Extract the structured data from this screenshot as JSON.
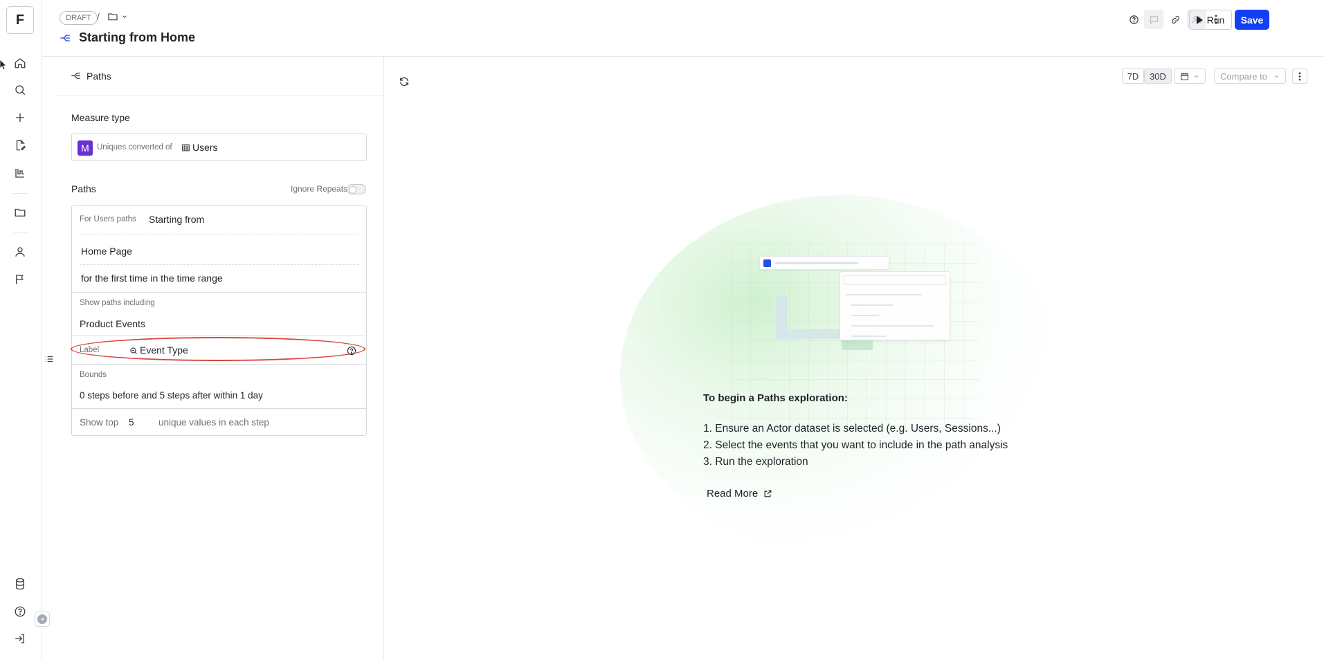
{
  "rail": {
    "logo_letter": "F",
    "icons": [
      "home-icon",
      "search-icon",
      "plus-icon",
      "edit-doc-icon",
      "flask-icon",
      "folder-icon",
      "user-icon",
      "flag-icon",
      "database-icon",
      "help-icon",
      "logout-icon"
    ]
  },
  "header": {
    "status": "DRAFT",
    "separator": "/",
    "title": "Starting from Home",
    "run_label": "Run",
    "save_label": "Save"
  },
  "panel": {
    "title": "Paths",
    "measure_type_heading": "Measure type",
    "measure_badge": "M",
    "measure_prefix": "Uniques converted of",
    "measure_entity": "Users",
    "paths_heading": "Paths",
    "ignore_repeats_label": "Ignore Repeats",
    "ignore_repeats_on": false,
    "for_paths_label": "For Users paths",
    "for_paths_value": "Starting from",
    "start_event": "Home Page",
    "start_qualifier": "for the first time in the time range",
    "show_paths_label": "Show paths including",
    "show_paths_value": "Product Events",
    "label_label": "Label",
    "label_value": "Event Type",
    "bounds_label": "Bounds",
    "bounds_value": "0 steps before and 5 steps after within 1 day",
    "show_top_label": "Show top",
    "show_top_value": "5",
    "show_top_suffix": "unique values in each step"
  },
  "main": {
    "range_7d": "7D",
    "range_30d": "30D",
    "compare_placeholder": "Compare to",
    "intro_heading": "To begin a Paths exploration:",
    "steps": [
      "1. Ensure an Actor dataset is selected (e.g. Users, Sessions...)",
      "2. Select the events that you want to include in the path analysis",
      "3. Run the exploration"
    ],
    "read_more": "Read More"
  },
  "colors": {
    "accent": "#1440f5",
    "badge": "#6b2fd6",
    "highlight_ring": "#d9473f"
  }
}
